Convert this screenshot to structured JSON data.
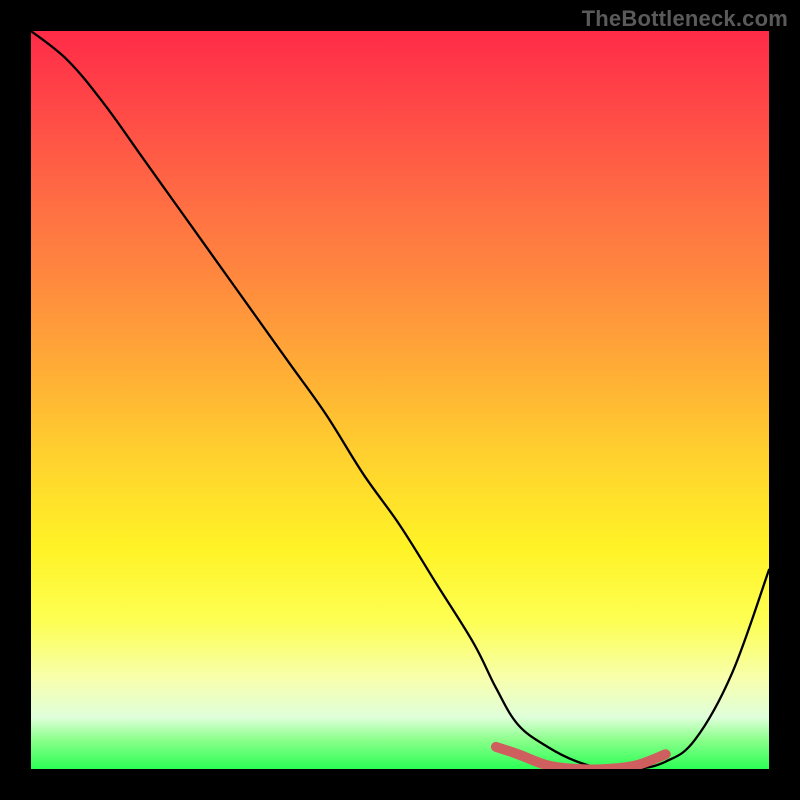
{
  "watermark": "TheBottleneck.com",
  "chart_data": {
    "type": "line",
    "title": "",
    "xlabel": "",
    "ylabel": "",
    "xlim": [
      0,
      100
    ],
    "ylim": [
      0,
      100
    ],
    "series": [
      {
        "name": "bottleneck-curve",
        "x": [
          0,
          5,
          10,
          15,
          20,
          25,
          30,
          35,
          40,
          45,
          50,
          55,
          60,
          63,
          66,
          70,
          74,
          78,
          82,
          86,
          90,
          95,
          100
        ],
        "values": [
          100,
          96,
          90,
          83,
          76,
          69,
          62,
          55,
          48,
          40,
          33,
          25,
          17,
          11,
          6,
          3,
          1,
          0,
          0,
          1,
          4,
          13,
          27
        ]
      },
      {
        "name": "highlight-band",
        "x": [
          63,
          66,
          70,
          74,
          78,
          82,
          86
        ],
        "values": [
          3,
          2,
          0.5,
          0,
          0,
          0.5,
          2
        ]
      }
    ],
    "colors": {
      "curve": "#000000",
      "highlight": "#cf5f5f"
    }
  }
}
